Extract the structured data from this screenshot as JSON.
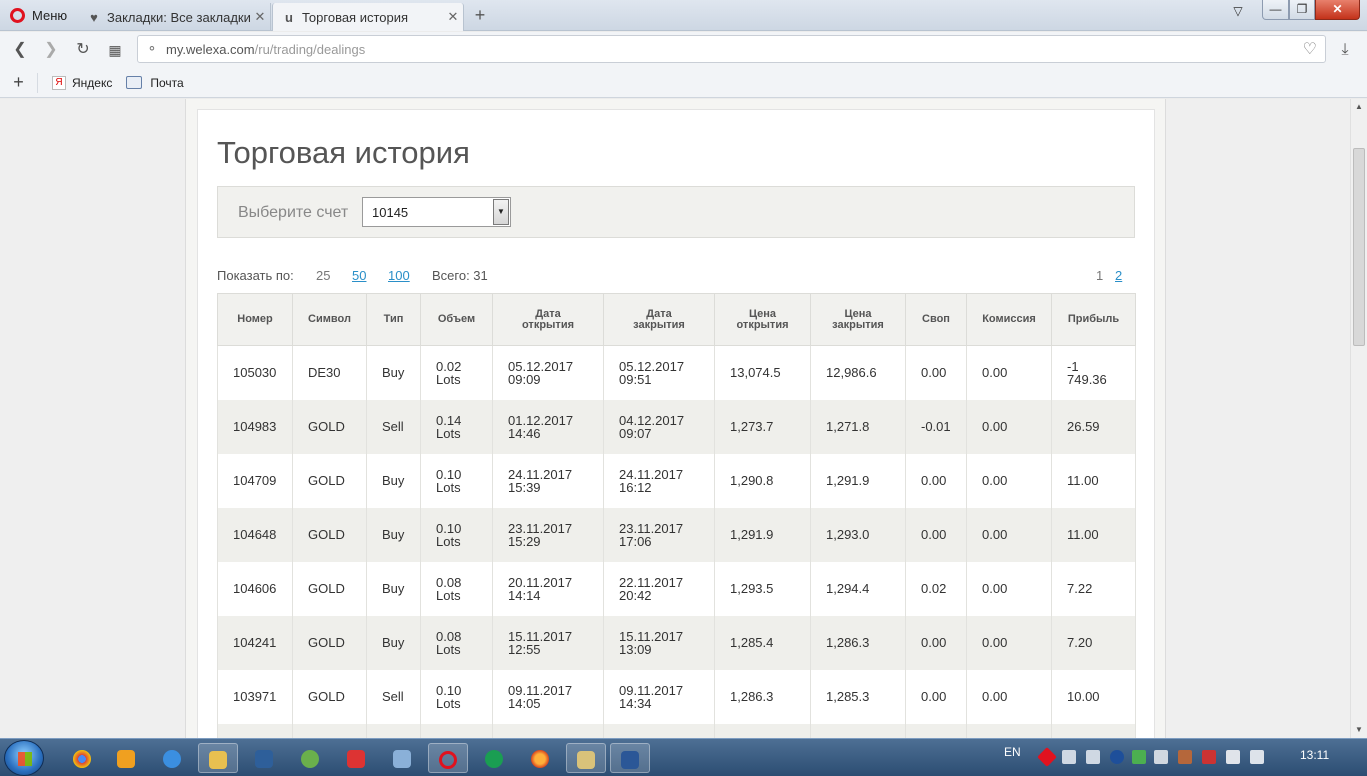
{
  "browser": {
    "menu_label": "Меню",
    "tabs": [
      {
        "title": "Закладки: Все закладки",
        "icon": "heart-icon"
      },
      {
        "title": "Торговая история",
        "icon": "welexa-favicon",
        "active": true
      }
    ],
    "new_tab_label": "+",
    "address": {
      "host": "my.welexa.com",
      "path": "/ru/trading/dealings"
    },
    "bookmarks": [
      {
        "label": "Яндекс",
        "icon": "yandex-icon"
      },
      {
        "label": "Почта",
        "icon": "mail-icon"
      }
    ]
  },
  "page": {
    "title": "Торговая история",
    "account": {
      "label": "Выберите счет",
      "selected": "10145"
    },
    "pager": {
      "show_label": "Показать по:",
      "sizes": [
        "25",
        "50",
        "100"
      ],
      "total_label": "Всего: 31",
      "pages": [
        "1",
        "2"
      ]
    },
    "table": {
      "headers": [
        "Номер",
        "Символ",
        "Тип",
        "Объем",
        "Дата\nоткрытия",
        "Дата\nзакрытия",
        "Цена\nоткрытия",
        "Цена\nзакрытия",
        "Своп",
        "Комиссия",
        "Прибыль"
      ],
      "rows": [
        [
          "105030",
          "DE30",
          "Buy",
          "0.02\nLots",
          "05.12.2017\n09:09",
          "05.12.2017\n09:51",
          "13,074.5",
          "12,986.6",
          "0.00",
          "0.00",
          "-1\n749.36"
        ],
        [
          "104983",
          "GOLD",
          "Sell",
          "0.14\nLots",
          "01.12.2017\n14:46",
          "04.12.2017\n09:07",
          "1,273.7",
          "1,271.8",
          "-0.01",
          "0.00",
          "26.59"
        ],
        [
          "104709",
          "GOLD",
          "Buy",
          "0.10\nLots",
          "24.11.2017\n15:39",
          "24.11.2017\n16:12",
          "1,290.8",
          "1,291.9",
          "0.00",
          "0.00",
          "11.00"
        ],
        [
          "104648",
          "GOLD",
          "Buy",
          "0.10\nLots",
          "23.11.2017\n15:29",
          "23.11.2017\n17:06",
          "1,291.9",
          "1,293.0",
          "0.00",
          "0.00",
          "11.00"
        ],
        [
          "104606",
          "GOLD",
          "Buy",
          "0.08\nLots",
          "20.11.2017\n14:14",
          "22.11.2017\n20:42",
          "1,293.5",
          "1,294.4",
          "0.02",
          "0.00",
          "7.22"
        ],
        [
          "104241",
          "GOLD",
          "Buy",
          "0.08\nLots",
          "15.11.2017\n12:55",
          "15.11.2017\n13:09",
          "1,285.4",
          "1,286.3",
          "0.00",
          "0.00",
          "7.20"
        ],
        [
          "103971",
          "GOLD",
          "Sell",
          "0.10\nLots",
          "09.11.2017\n14:05",
          "09.11.2017\n14:34",
          "1,286.3",
          "1,285.3",
          "0.00",
          "0.00",
          "10.00"
        ],
        [
          "",
          "",
          "",
          "",
          "",
          "",
          "",
          "",
          "",
          "",
          ""
        ]
      ]
    }
  },
  "taskbar": {
    "language": "EN",
    "clock": "13:11",
    "apps": [
      "chrome-icon",
      "media-player-icon",
      "ie-icon",
      "explorer-icon",
      "app-icon",
      "people-icon",
      "yandex-icon",
      "speaker-icon",
      "opera-icon",
      "green-app-icon",
      "firefox-icon",
      "chart-app-icon",
      "word-icon"
    ]
  },
  "colors": {
    "link": "#2a8fc8",
    "opera_red": "#e0121f",
    "header_bg": "#f1f1ee"
  }
}
